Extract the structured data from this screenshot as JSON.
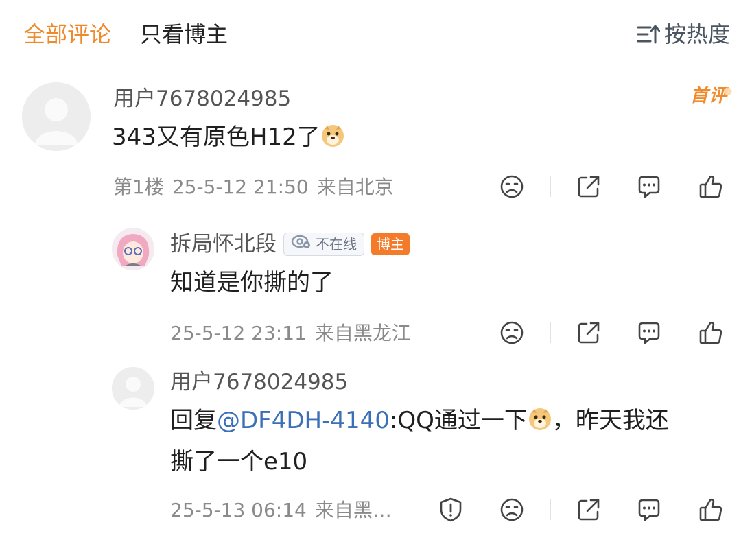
{
  "tabs": {
    "all": "全部评论",
    "blogger_only": "只看博主"
  },
  "sort": {
    "label": "按热度",
    "icon": "sort-icon"
  },
  "comment": {
    "username": "用户7678024985",
    "badge": "首评",
    "text": "343又有原色H12了",
    "emoji": "doge-emoji",
    "floor": "第1楼",
    "time": "25-5-12 21:50",
    "location": "来自北京"
  },
  "replies": [
    {
      "username": "拆局怀北段",
      "status": "不在线",
      "role_badge": "博主",
      "text": "知道是你撕的了",
      "time": "25-5-12 23:11",
      "location": "来自黑龙江"
    },
    {
      "username": "用户7678024985",
      "reply_prefix": "回复",
      "mention": "@DF4DH-4140",
      "text_after_mention": ":QQ通过一下",
      "emoji": "doge-emoji",
      "text_tail": "，昨天我还",
      "text_line2": "撕了一个e10",
      "time": "25-5-13 06:14",
      "location": "来自黑…"
    }
  ],
  "icons": [
    "dislike-icon",
    "share-icon",
    "comment-icon",
    "like-icon",
    "report-icon"
  ],
  "colors": {
    "accent": "#ef8a2a",
    "blogger_badge": "#f47b2a",
    "mention": "#3b6fb6",
    "meta": "#8a8a8a"
  }
}
